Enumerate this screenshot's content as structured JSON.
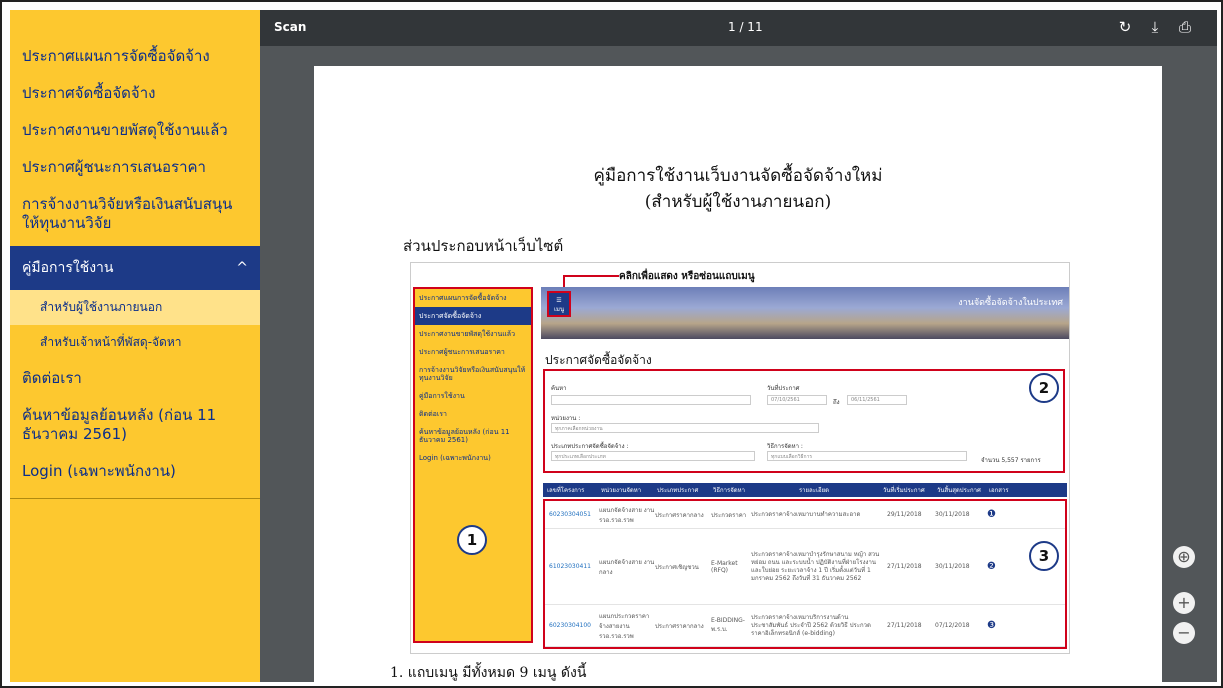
{
  "sidebar": {
    "items": [
      {
        "label": "ประกาศแผนการจัดซื้อจัดจ้าง"
      },
      {
        "label": "ประกาศจัดซื้อจัดจ้าง"
      },
      {
        "label": "ประกาศงานขายพัสดุใช้งานแล้ว"
      },
      {
        "label": "ประกาศผู้ชนะการเสนอราคา"
      },
      {
        "label": "การจ้างงานวิจัยหรือเงินสนับสนุนให้ทุนงานวิจัย"
      }
    ],
    "section": {
      "label": "คู่มือการใช้งาน",
      "caret": "^"
    },
    "subitems": [
      {
        "label": "สำหรับผู้ใช้งานภายนอก"
      },
      {
        "label": "สำหรับเจ้าหน้าที่พัสดุ-จัดหา"
      }
    ],
    "items_after": [
      {
        "label": "ติดต่อเรา"
      },
      {
        "label": "ค้นหาข้อมูลย้อนหลัง (ก่อน 11 ธันวาคม 2561)"
      },
      {
        "label": "Login (เฉพาะพนักงาน)"
      }
    ]
  },
  "viewer": {
    "title": "Scan",
    "page_indicator": "1 / 11",
    "icons": [
      "rotate-icon",
      "download-icon",
      "print-icon"
    ]
  },
  "document": {
    "title_line1": "คู่มือการใช้งานเว็บงานจัดซื้อจัดจ้างใหม่",
    "title_line2": "(สำหรับผู้ใช้งานภายนอก)",
    "section_title": "ส่วนประกอบหน้าเว็บไซต์",
    "bottom_text": "1. แถบเมนู มีทั้งหมด 9 เมนู ดังนี้",
    "mock": {
      "callout": "คลิกเพื่อแสดง หรือซ่อนแถบเมนู",
      "menu_btn": "เมนู",
      "banner_text": "งานจัดซื้อจัดจ้างในประเทศ",
      "page_title": "ประกาศจัดซื้อจัดจ้าง",
      "side_items": [
        "ประกาศแผนการจัดซื้อจัดจ้าง",
        "ประกาศจัดซื้อจัดจ้าง",
        "ประกาศงานขายพัสดุใช้งานแล้ว",
        "ประกาศผู้ชนะการเสนอราคา",
        "การจ้างงานวิจัยหรือเงินสนับสนุนให้ทุนงานวิจัย",
        "คู่มือการใช้งาน",
        "ติดต่อเรา",
        "ค้นหาข้อมูลย้อนหลัง (ก่อน 11 ธันวาคม 2561)",
        "Login (เฉพาะพนักงาน)"
      ],
      "filter": {
        "search_label": "ค้นหา",
        "date_label": "วันที่ประกาศ",
        "date_from": "07/10/2561",
        "date_sep": "ถึง",
        "date_to": "06/11/2561",
        "unit_label": "หน่วยงาน :",
        "unit_value": "ทุกภาคเลือกหน่วยงาน",
        "type_label": "ประเภทประกาศจัดซื้อจัดจ้าง :",
        "type_value": "ทุกประเภทเลือกประเภท",
        "method_label": "วิธีการจัดหา :",
        "method_value": "ทุกแบบเลือกวิธีการ",
        "count": "จำนวน 5,557 รายการ"
      },
      "table": {
        "headers": [
          "เลขที่โครงการ",
          "หน่วยงานจัดหา",
          "ประเภทประกาศ",
          "วิธีการจัดหา",
          "รายละเอียด",
          "วันที่เริ่มประกาศ",
          "วันสิ้นสุดประกาศ",
          "เอกสาร"
        ],
        "rows": [
          [
            "60230304051",
            "แผนกจัดจ้างสาย งาน รวอ.รวอ.รวพ",
            "ประกาศราคากลาง",
            "ประกวดราคา",
            "ประกวดราคาจ้างเหมาบานทำความสะอาด",
            "29/11/2018",
            "30/11/2018",
            "❶"
          ],
          [
            "61023030411",
            "แผนกจัดจ้างสาย งานกลาง",
            "ประกาศเชิญชวน",
            "E-Market (RFQ)",
            "ประกวดราคาจ้างเหมาบำรุงรักษาสนาม หญ้า สวนหย่อม ถนน และระบบน้ำ ปฏิบัติงานที่ฝ่ายโรงงานและใบย่อย ระยะเวลาจ้าง 1 ปี เริ่มตั้งแต่วันที่ 1 มกราคม 2562 ถึงวันที่ 31 ธันวาคม 2562",
            "27/11/2018",
            "30/11/2018",
            "❷"
          ],
          [
            "60230304100",
            "แผนกประกวดราคา จ้างสายงาน รวอ.รวอ.รวพ",
            "ประกาศราคากลาง",
            "E-BIDDING-พ.ร.บ.",
            "ประกวดราคาจ้างเหมาบริการงานด้าน ประชาสัมพันธ์ ประจำปี 2562 ด้วยวิธี ประกวดราคาอิเล็กทรอนิกส์ (e-bidding)",
            "27/11/2018",
            "07/12/2018",
            "❸"
          ]
        ]
      },
      "markers": [
        "1",
        "2",
        "3"
      ]
    }
  },
  "zoom": {
    "fit": "⊕",
    "plus": "+",
    "minus": "−"
  }
}
